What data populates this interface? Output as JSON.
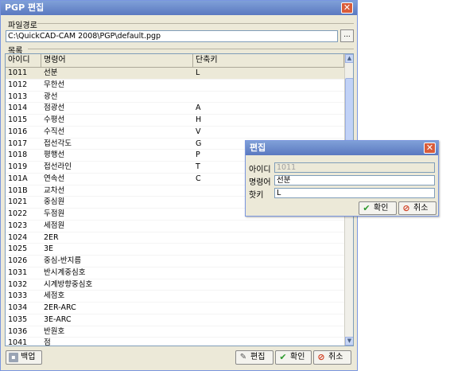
{
  "window": {
    "title": "PGP 편집",
    "close_label": "✕"
  },
  "path_group": {
    "label": "파일경로",
    "path_value": "C:\\QuickCAD-CAM 2008\\PGP\\default.pgp",
    "browse_label": "..."
  },
  "list_group": {
    "label": "목록",
    "columns": [
      "아이디",
      "명령어",
      "단축키"
    ],
    "rows": [
      {
        "id": "1011",
        "command": "선분",
        "key": "L",
        "selected": true
      },
      {
        "id": "1012",
        "command": "무한선",
        "key": ""
      },
      {
        "id": "1013",
        "command": "광선",
        "key": ""
      },
      {
        "id": "1014",
        "command": "점광선",
        "key": "A"
      },
      {
        "id": "1015",
        "command": "수평선",
        "key": "H"
      },
      {
        "id": "1016",
        "command": "수직선",
        "key": "V"
      },
      {
        "id": "1017",
        "command": "접선각도",
        "key": "G"
      },
      {
        "id": "1018",
        "command": "평행선",
        "key": "P"
      },
      {
        "id": "1019",
        "command": "접선라인",
        "key": "T"
      },
      {
        "id": "101A",
        "command": "연속선",
        "key": "C"
      },
      {
        "id": "101B",
        "command": "교차선",
        "key": ""
      },
      {
        "id": "1021",
        "command": "중심원",
        "key": ""
      },
      {
        "id": "1022",
        "command": "두점원",
        "key": ""
      },
      {
        "id": "1023",
        "command": "세점원",
        "key": ""
      },
      {
        "id": "1024",
        "command": "2ER",
        "key": ""
      },
      {
        "id": "1025",
        "command": "3E",
        "key": ""
      },
      {
        "id": "1026",
        "command": "중심-반지름",
        "key": ""
      },
      {
        "id": "1031",
        "command": "반시계중심호",
        "key": ""
      },
      {
        "id": "1032",
        "command": "시계방향중심호",
        "key": ""
      },
      {
        "id": "1033",
        "command": "세점호",
        "key": ""
      },
      {
        "id": "1034",
        "command": "2ER-ARC",
        "key": ""
      },
      {
        "id": "1035",
        "command": "3E-ARC",
        "key": ""
      },
      {
        "id": "1036",
        "command": "반원호",
        "key": ""
      },
      {
        "id": "1041",
        "command": "점",
        "key": ""
      }
    ]
  },
  "buttons": {
    "backup": "백업",
    "edit": "편집",
    "ok": "확인",
    "cancel": "취소"
  },
  "edit_dialog": {
    "title": "편집",
    "close_label": "✕",
    "id_label": "아이디",
    "id_value": "1011",
    "command_label": "명령어",
    "command_value": "선분",
    "key_label": "핫키",
    "key_value": "L",
    "ok": "확인",
    "cancel": "취소"
  },
  "colors": {
    "title_bar": "#6a8bd0",
    "selected_row": "#ece9d8",
    "ok_icon": "#2e9a2e",
    "cancel_icon": "#d03b1e"
  }
}
